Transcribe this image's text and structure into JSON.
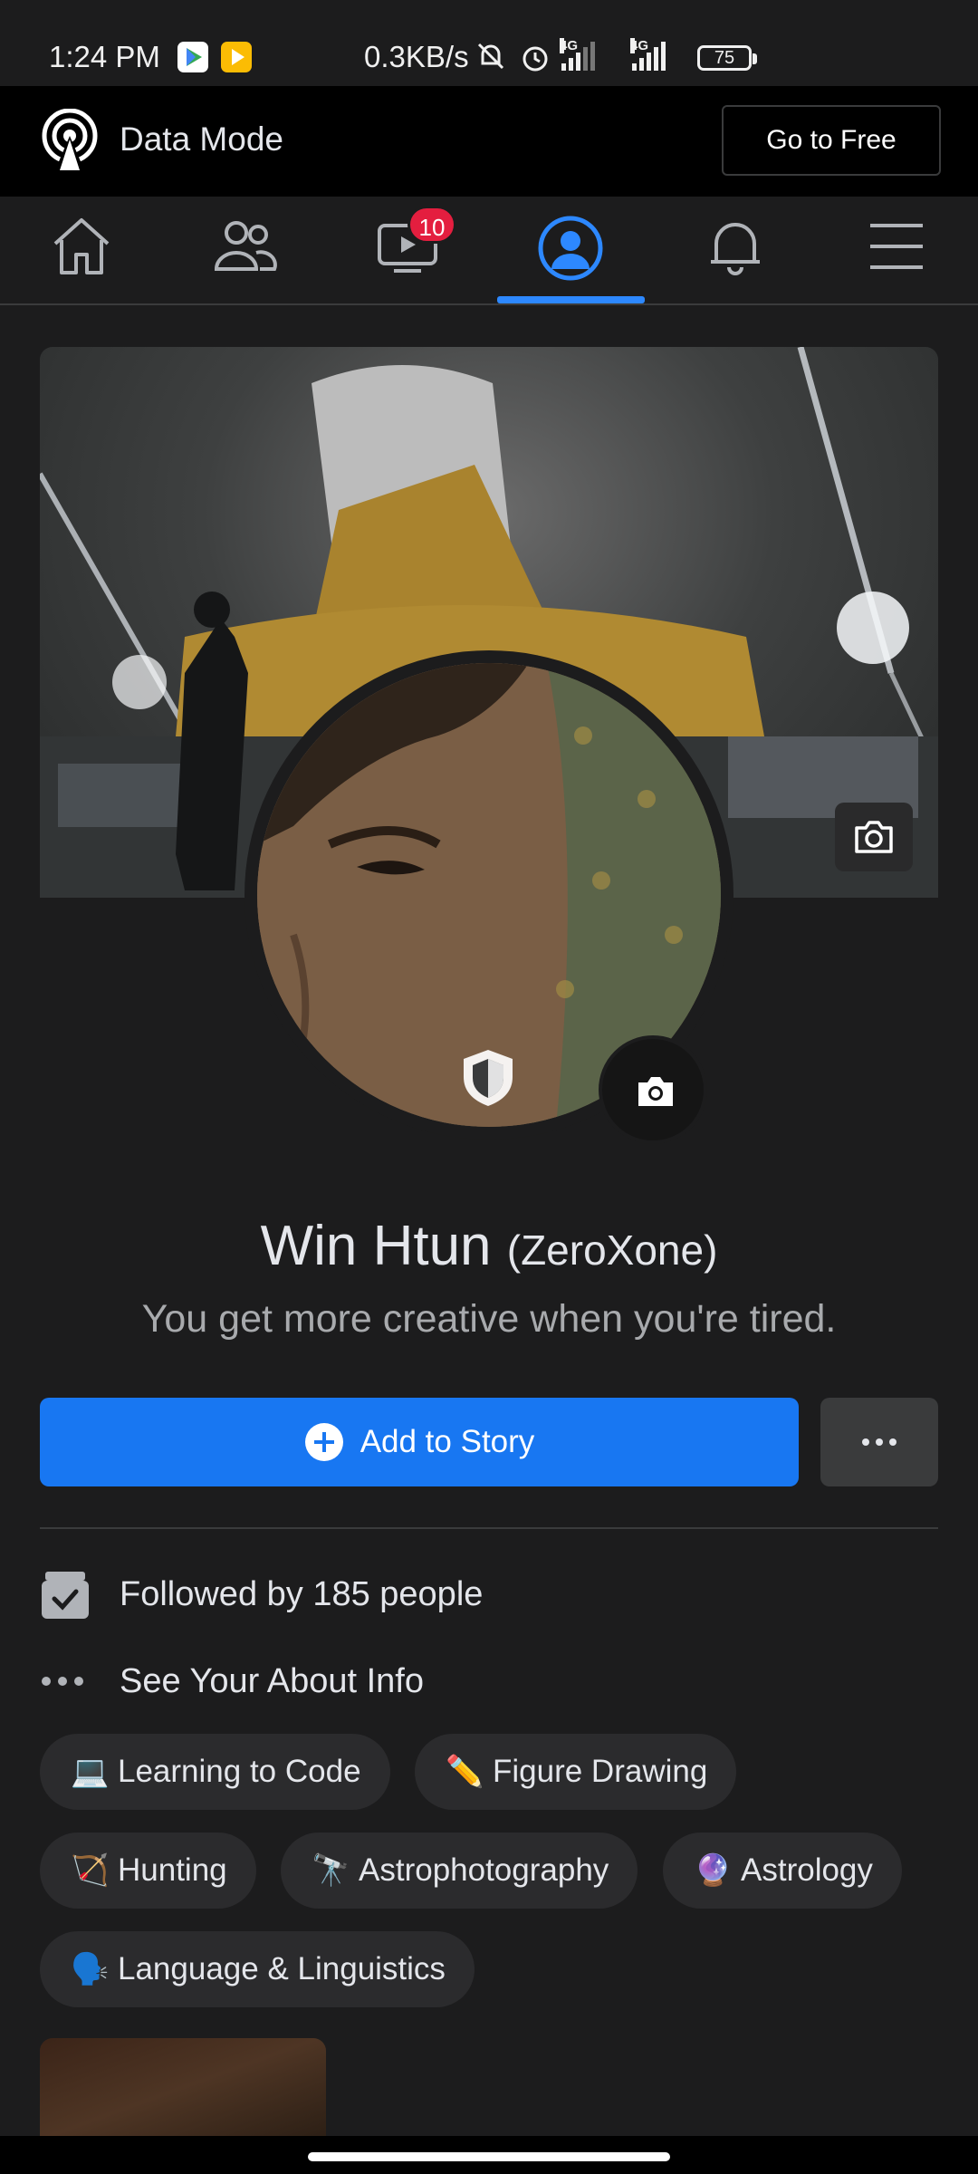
{
  "status_bar": {
    "time": "1:24 PM",
    "speed": "0.3KB/s",
    "network_1": "4G",
    "network_2": "4G",
    "battery": "75"
  },
  "data_mode": {
    "label": "Data Mode",
    "go_free_label": "Go to Free"
  },
  "nav": {
    "items": [
      {
        "name": "home",
        "icon": "home-icon"
      },
      {
        "name": "friends",
        "icon": "friends-icon"
      },
      {
        "name": "watch",
        "icon": "video-icon",
        "badge": "10"
      },
      {
        "name": "profile",
        "icon": "profile-icon",
        "active": true
      },
      {
        "name": "notifications",
        "icon": "bell-icon"
      },
      {
        "name": "menu",
        "icon": "hamburger-menu-icon"
      }
    ]
  },
  "profile": {
    "name": "Win Htun",
    "alt_name": "(ZeroXone)",
    "bio": "You get more creative when you're tired."
  },
  "actions": {
    "add_story_label": "Add to Story"
  },
  "info": {
    "followed_by": "Followed by 185 people",
    "about_label": "See Your About Info"
  },
  "hobbies": [
    {
      "emoji": "💻",
      "label": "Learning to Code"
    },
    {
      "emoji": "✏️",
      "label": "Figure Drawing"
    },
    {
      "emoji": "🏹",
      "label": "Hunting"
    },
    {
      "emoji": "🔭",
      "label": "Astrophotography"
    },
    {
      "emoji": "🔮",
      "label": "Astrology"
    },
    {
      "emoji": "🗣️",
      "label": "Language & Linguistics"
    }
  ],
  "colors": {
    "accent": "#1877f2",
    "active_tab": "#2d88ff",
    "badge": "#e41e3f",
    "background": "#1c1c1d"
  }
}
